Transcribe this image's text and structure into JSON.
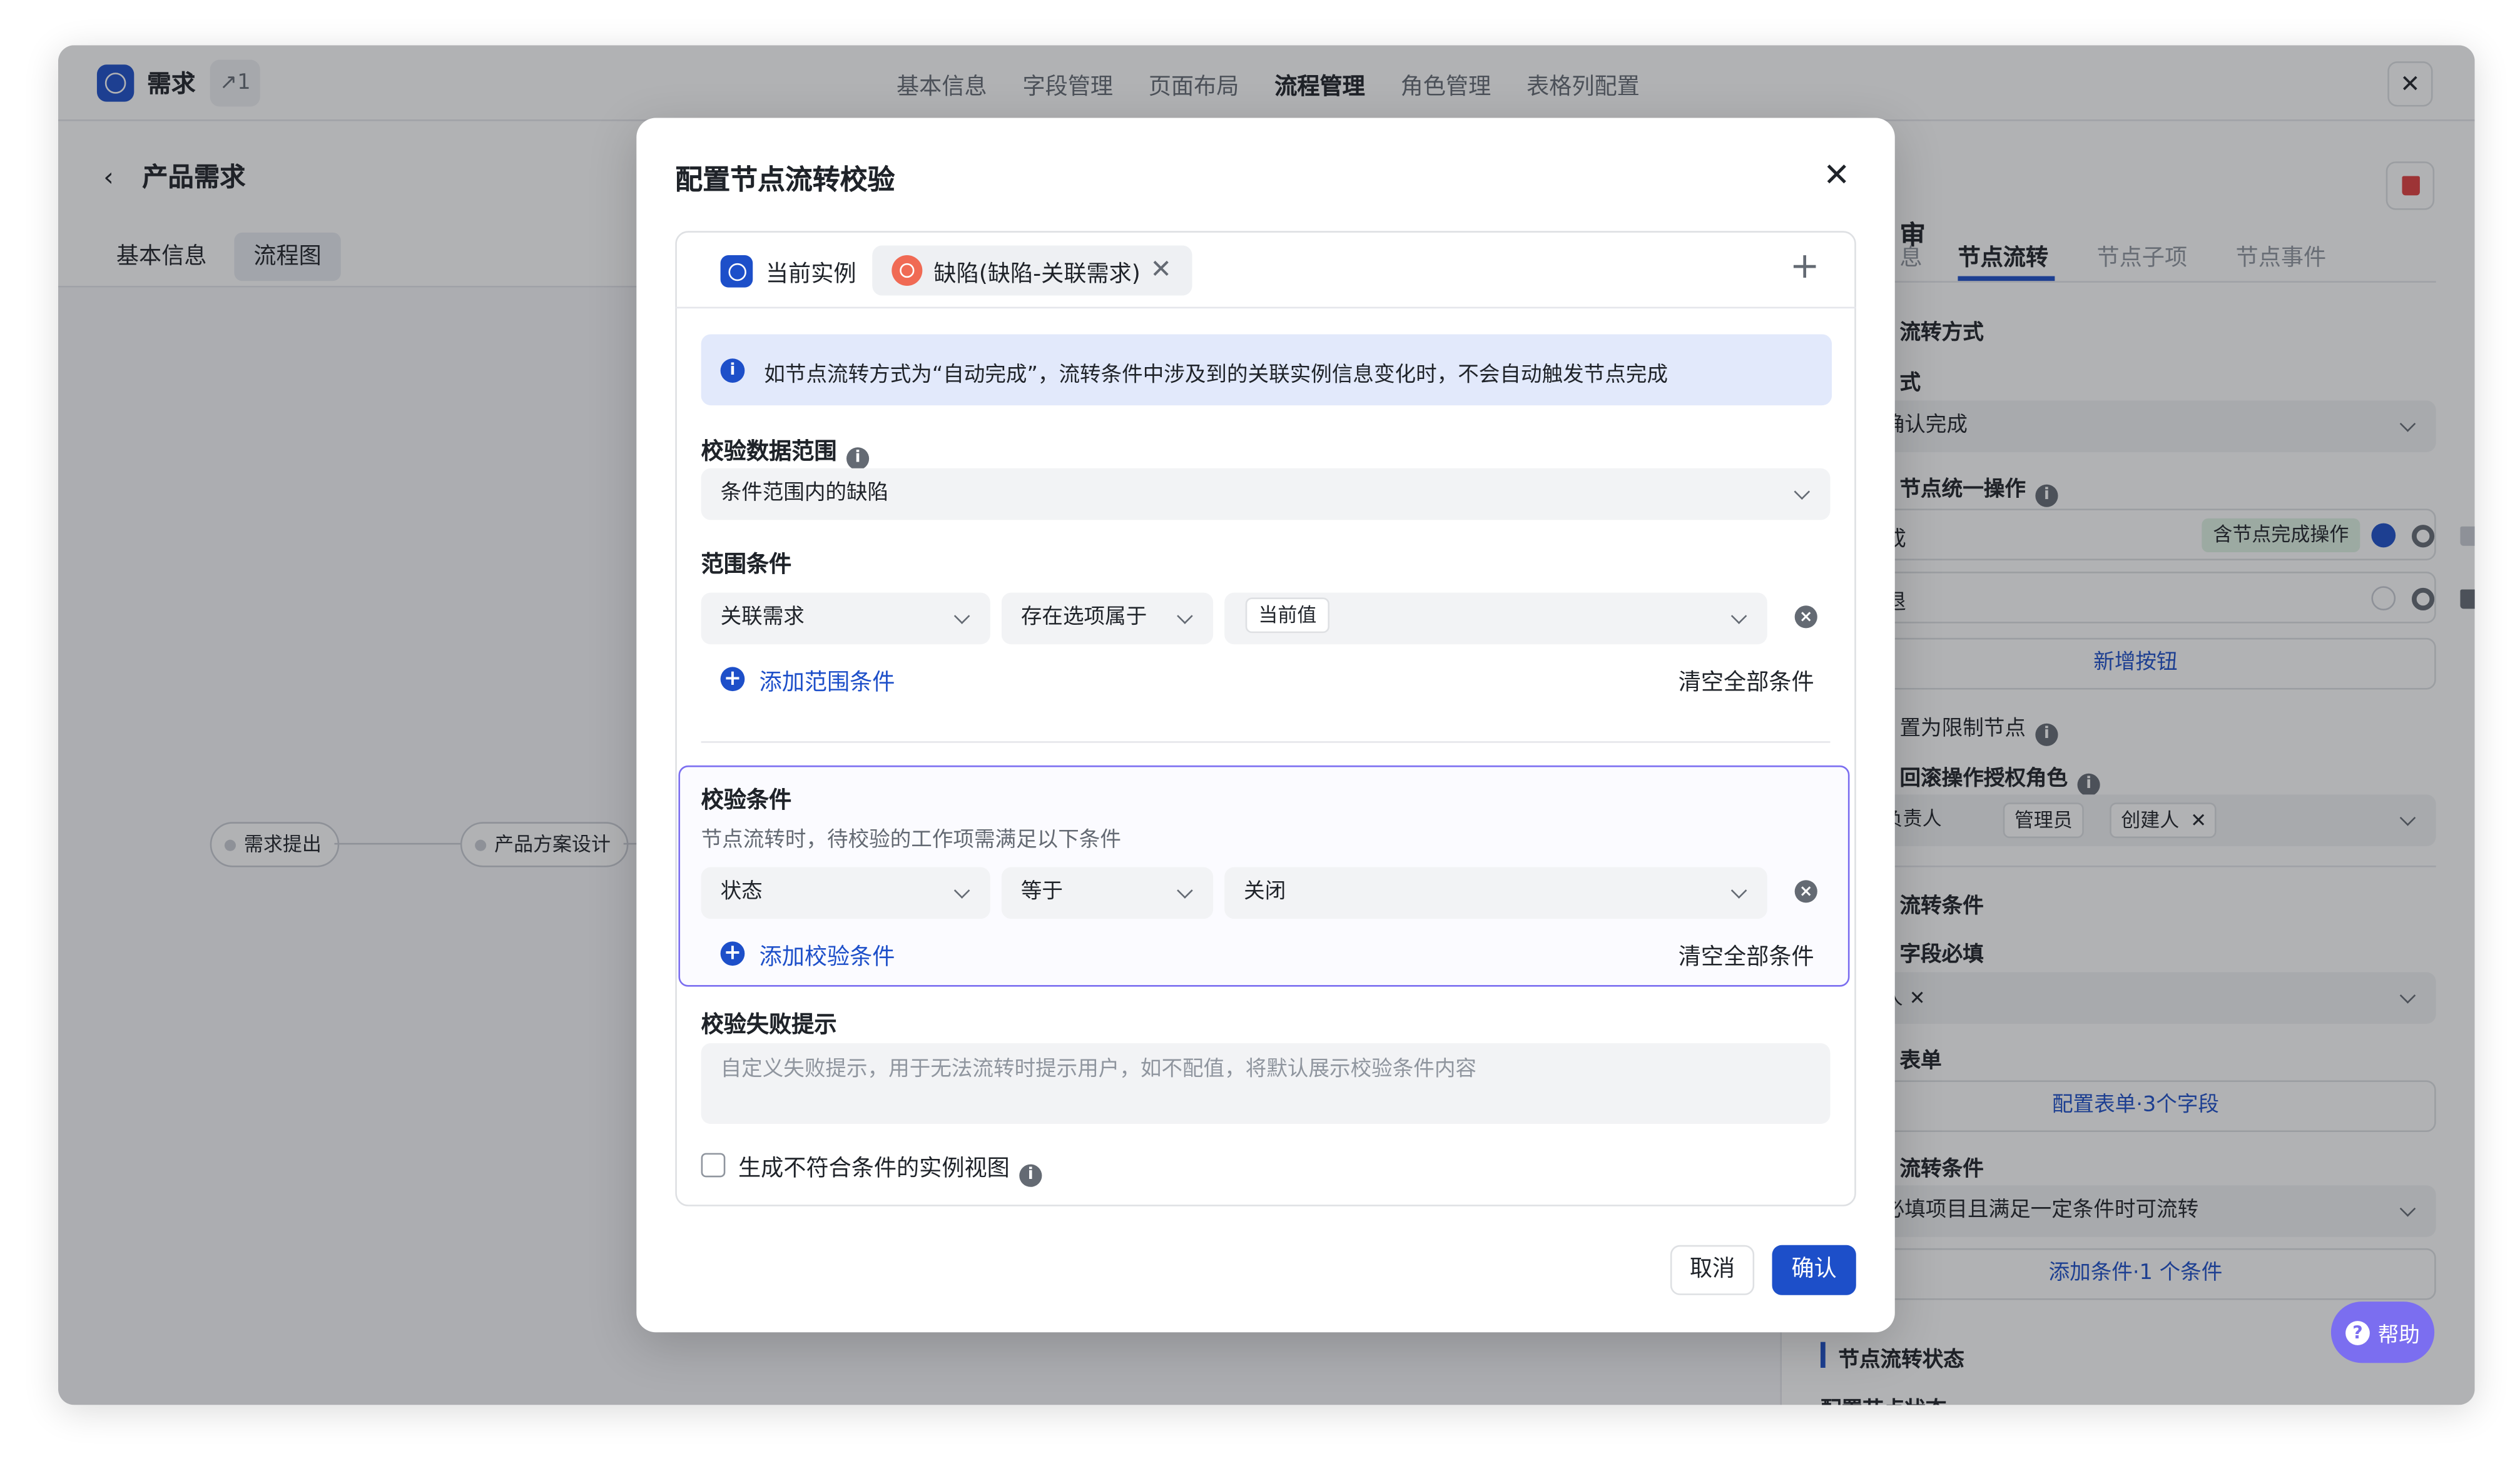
{
  "app": {
    "name": "需求",
    "count": "↗1",
    "close_icon": "close-icon"
  },
  "top_tabs": [
    {
      "label": "基本信息",
      "active": false
    },
    {
      "label": "字段管理",
      "active": false
    },
    {
      "label": "页面布局",
      "active": false
    },
    {
      "label": "流程管理",
      "active": true
    },
    {
      "label": "角色管理",
      "active": false
    },
    {
      "label": "表格列配置",
      "active": false
    }
  ],
  "page": {
    "title": "产品需求",
    "sub_tabs": [
      {
        "label": "基本信息",
        "active": false
      },
      {
        "label": "流程图",
        "active": true
      }
    ]
  },
  "flow": {
    "nodes": [
      "需求提出",
      "产品方案设计"
    ]
  },
  "right_panel": {
    "title": "审",
    "tabs": [
      {
        "label": "息",
        "active": false
      },
      {
        "label": "节点流转",
        "active": true
      },
      {
        "label": "节点子项",
        "active": false
      },
      {
        "label": "节点事件",
        "active": false
      }
    ],
    "flow_method_label": "流转方式",
    "method_label": "式",
    "method_value": "确认完成",
    "unified_op_label": "节点统一操作",
    "op1_text": "成",
    "op1_badge": "含节点完成操作",
    "op2_text": "退",
    "add_button_label": "新增按钮",
    "restrict_label": "置为限制节点",
    "rollback_role_label": "回滚操作授权角色",
    "role_tags": [
      "负责人",
      "管理员",
      "创建人"
    ],
    "transfer_cond_label": "流转条件",
    "field_required_label": "字段必填",
    "field_tag": "人",
    "form_label": "表单",
    "form_link": "配置表单·3个字段",
    "cond_label": "流转条件",
    "cond_value": "必填项目且满足一定条件时可流转",
    "cond_link": "添加条件·1 个条件",
    "status_label": "节点流转状态",
    "status_sub": "配置节点状态"
  },
  "help": {
    "label": "帮助"
  },
  "modal": {
    "title": "配置节点流转校验",
    "tab_current": "当前实例",
    "tab_related": "缺陷(缺陷-关联需求)",
    "alert": "如节点流转方式为“自动完成”，流转条件中涉及到的关联实例信息变化时，不会自动触发节点完成",
    "scope_label": "校验数据范围",
    "scope_value": "条件范围内的缺陷",
    "range_label": "范围条件",
    "range_field": "关联需求",
    "range_op": "存在选项属于",
    "range_value_tag": "当前值",
    "add_range": "添加范围条件",
    "clear_all": "清空全部条件",
    "check_label": "校验条件",
    "check_desc": "节点流转时，待校验的工作项需满足以下条件",
    "check_field": "状态",
    "check_op": "等于",
    "check_value": "关闭",
    "add_check": "添加校验条件",
    "clear_all_2": "清空全部条件",
    "fail_label": "校验失败提示",
    "fail_placeholder": "自定义失败提示，用于无法流转时提示用户，如不配值，将默认展示校验条件内容",
    "checkbox_label": "生成不符合条件的实例视图",
    "cancel": "取消",
    "confirm": "确认"
  },
  "colors": {
    "accent": "#1d4fc9",
    "purple": "#7b6ef0",
    "danger": "#e03e3e",
    "green_badge": "#dff3e4"
  }
}
